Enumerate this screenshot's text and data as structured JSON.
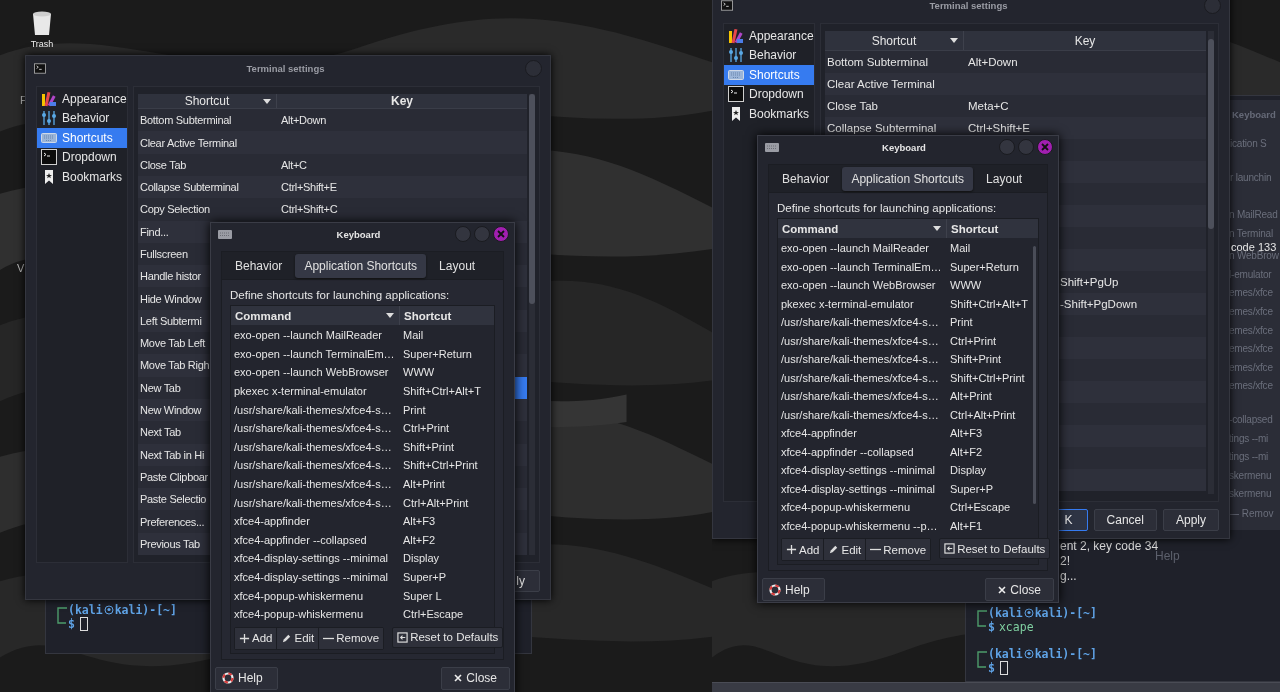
{
  "left_screen": {
    "desktop_icons": [
      {
        "label": "Trash"
      }
    ],
    "desktop_fragments": [
      "F",
      "V"
    ],
    "terminal": {
      "prompts": [
        {
          "before_symbol": "(kali",
          "after_symbol": "kali)-[~]",
          "sign": "$",
          "cursor": true
        }
      ]
    },
    "settings_window": {
      "title": "Terminal settings",
      "sidebar": [
        {
          "label": "Appearance",
          "selected": false
        },
        {
          "label": "Behavior",
          "selected": false
        },
        {
          "label": "Shortcuts",
          "selected": true
        },
        {
          "label": "Dropdown",
          "selected": false
        },
        {
          "label": "Bookmarks",
          "selected": false
        }
      ],
      "columns": [
        "Shortcut",
        "Key"
      ],
      "rows": [
        {
          "action": "Bottom Subterminal",
          "key": "Alt+Down",
          "selected": false
        },
        {
          "action": "Clear Active Terminal",
          "selected": false
        },
        {
          "action": "Close Tab",
          "key": "Alt+C",
          "selected": false
        },
        {
          "action": "Collapse Subterminal",
          "key": "Ctrl+Shift+E",
          "selected": false
        },
        {
          "action": "Copy Selection",
          "key": "Ctrl+Shift+C",
          "selected": false
        },
        {
          "action": "Find...",
          "selected": false
        },
        {
          "action": "Fullscreen",
          "selected": false
        },
        {
          "action": "Handle histor",
          "selected": false
        },
        {
          "action": "Hide Window",
          "selected": false
        },
        {
          "action": "Left Subtermi",
          "selected": false
        },
        {
          "action": "Move Tab Left",
          "selected": false
        },
        {
          "action": "Move Tab Righ",
          "selected": false
        },
        {
          "action": "New Tab",
          "selected": true
        },
        {
          "action": "New Window",
          "selected": false
        },
        {
          "action": "Next Tab",
          "selected": false
        },
        {
          "action": "Next Tab in Hi",
          "selected": false
        },
        {
          "action": "Paste Clipboar",
          "selected": false
        },
        {
          "action": "Paste Selectio",
          "selected": false
        },
        {
          "action": "Preferences...",
          "selected": false
        },
        {
          "action": "Previous Tab",
          "selected": false
        }
      ],
      "buttons": [
        {
          "label": "ly",
          "default": false
        }
      ]
    },
    "keyboard_dialog": {
      "title": "Keyboard",
      "tabs": [
        {
          "label": "Behavior",
          "selected": false
        },
        {
          "label": "Application Shortcuts",
          "selected": true
        },
        {
          "label": "Layout",
          "selected": false
        }
      ],
      "description": "Define shortcuts for launching applications:",
      "columns": [
        "Command",
        "Shortcut"
      ],
      "rows": [
        {
          "command": "exo-open --launch MailReader",
          "shortcut": "Mail"
        },
        {
          "command": "exo-open --launch TerminalEm…",
          "shortcut": "Super+Return"
        },
        {
          "command": "exo-open --launch WebBrowser",
          "shortcut": "WWW"
        },
        {
          "command": "pkexec x-terminal-emulator",
          "shortcut": "Shift+Ctrl+Alt+T"
        },
        {
          "command": "/usr/share/kali-themes/xfce4-s…",
          "shortcut": "Print"
        },
        {
          "command": "/usr/share/kali-themes/xfce4-s…",
          "shortcut": "Ctrl+Print"
        },
        {
          "command": "/usr/share/kali-themes/xfce4-s…",
          "shortcut": "Shift+Print"
        },
        {
          "command": "/usr/share/kali-themes/xfce4-s…",
          "shortcut": "Shift+Ctrl+Print"
        },
        {
          "command": "/usr/share/kali-themes/xfce4-s…",
          "shortcut": "Alt+Print"
        },
        {
          "command": "/usr/share/kali-themes/xfce4-s…",
          "shortcut": "Ctrl+Alt+Print"
        },
        {
          "command": "xfce4-appfinder",
          "shortcut": "Alt+F3"
        },
        {
          "command": "xfce4-appfinder --collapsed",
          "shortcut": "Alt+F2"
        },
        {
          "command": "xfce4-display-settings --minimal",
          "shortcut": "Display"
        },
        {
          "command": "xfce4-display-settings --minimal",
          "shortcut": "Super+P"
        },
        {
          "command": "xfce4-popup-whiskermenu",
          "shortcut": "Super L"
        },
        {
          "command": "xfce4-popup-whiskermenu",
          "shortcut": "Ctrl+Escape"
        }
      ],
      "actions": [
        "Add",
        "Edit",
        "Remove",
        "Reset to Defaults"
      ],
      "help": "Help",
      "close": "Close"
    }
  },
  "right_screen": {
    "terminal": {
      "output_top": [
        "code 133"
      ],
      "output": [
        "ent 2, key code 34",
        "2!",
        "g..."
      ],
      "prompts": [
        {
          "before_symbol": "(kali",
          "after_symbol": "kali)-[~]",
          "sign": "$",
          "command": "xcape",
          "cursor": false
        },
        {
          "before_symbol": "(kali",
          "after_symbol": "kali)-[~]",
          "sign": "$",
          "cursor": true
        }
      ]
    },
    "ghost_window": {
      "title": "Keyboard",
      "header_lines": [
        "ication S",
        "r launchin"
      ],
      "rows_upper": [
        "n MailRead",
        "n Terminal",
        "n WebBrow",
        "l-emulator",
        "emes/xfce",
        "emes/xfce",
        "emes/xfce",
        "emes/xfce",
        "emes/xfce",
        "emes/xfce"
      ],
      "rows_lower": [
        "-collapsed",
        "tings --mi",
        "tings --mi",
        "skermenu",
        "skermenu"
      ],
      "remove": "— Remov",
      "help": "Help"
    },
    "settings_window": {
      "title": "Terminal settings",
      "sidebar": [
        {
          "label": "Appearance",
          "selected": false
        },
        {
          "label": "Behavior",
          "selected": false
        },
        {
          "label": "Shortcuts",
          "selected": true
        },
        {
          "label": "Dropdown",
          "selected": false
        },
        {
          "label": "Bookmarks",
          "selected": false
        }
      ],
      "columns": [
        "Shortcut",
        "Key"
      ],
      "rows": [
        {
          "action": "Bottom Subterminal",
          "key": "Alt+Down",
          "selected": false
        },
        {
          "action": "Clear Active Terminal",
          "selected": false
        },
        {
          "action": "Close Tab",
          "key": "Meta+C",
          "selected": false
        },
        {
          "action": "Collapse Subterminal",
          "key": "Ctrl+Shift+E",
          "selected": false
        }
      ],
      "covered_rows": [
        {
          "key": "Shift+PgUp"
        },
        {
          "key": "-Shift+PgDown"
        }
      ],
      "buttons": [
        {
          "label": "K",
          "default": true
        },
        {
          "label": "Cancel",
          "default": false
        },
        {
          "label": "Apply",
          "default": false
        }
      ]
    },
    "keyboard_dialog": {
      "title": "Keyboard",
      "tabs": [
        {
          "label": "Behavior",
          "selected": false
        },
        {
          "label": "Application Shortcuts",
          "selected": true
        },
        {
          "label": "Layout",
          "selected": false
        }
      ],
      "description": "Define shortcuts for launching applications:",
      "columns": [
        "Command",
        "Shortcut"
      ],
      "rows": [
        {
          "command": "exo-open --launch MailReader",
          "shortcut": "Mail"
        },
        {
          "command": "exo-open --launch TerminalEm…",
          "shortcut": "Super+Return"
        },
        {
          "command": "exo-open --launch WebBrowser",
          "shortcut": "WWW"
        },
        {
          "command": "pkexec x-terminal-emulator",
          "shortcut": "Shift+Ctrl+Alt+T"
        },
        {
          "command": "/usr/share/kali-themes/xfce4-s…",
          "shortcut": "Print"
        },
        {
          "command": "/usr/share/kali-themes/xfce4-s…",
          "shortcut": "Ctrl+Print"
        },
        {
          "command": "/usr/share/kali-themes/xfce4-s…",
          "shortcut": "Shift+Print"
        },
        {
          "command": "/usr/share/kali-themes/xfce4-s…",
          "shortcut": "Shift+Ctrl+Print"
        },
        {
          "command": "/usr/share/kali-themes/xfce4-s…",
          "shortcut": "Alt+Print"
        },
        {
          "command": "/usr/share/kali-themes/xfce4-s…",
          "shortcut": "Ctrl+Alt+Print"
        },
        {
          "command": "xfce4-appfinder",
          "shortcut": "Alt+F3"
        },
        {
          "command": "xfce4-appfinder --collapsed",
          "shortcut": "Alt+F2"
        },
        {
          "command": "xfce4-display-settings --minimal",
          "shortcut": "Display"
        },
        {
          "command": "xfce4-display-settings --minimal",
          "shortcut": "Super+P"
        },
        {
          "command": "xfce4-popup-whiskermenu",
          "shortcut": "Ctrl+Escape"
        },
        {
          "command": "xfce4-popup-whiskermenu --p…",
          "shortcut": "Alt+F1"
        }
      ],
      "actions": [
        "Add",
        "Edit",
        "Remove",
        "Reset to Defaults"
      ],
      "help": "Help",
      "close": "Close"
    }
  }
}
